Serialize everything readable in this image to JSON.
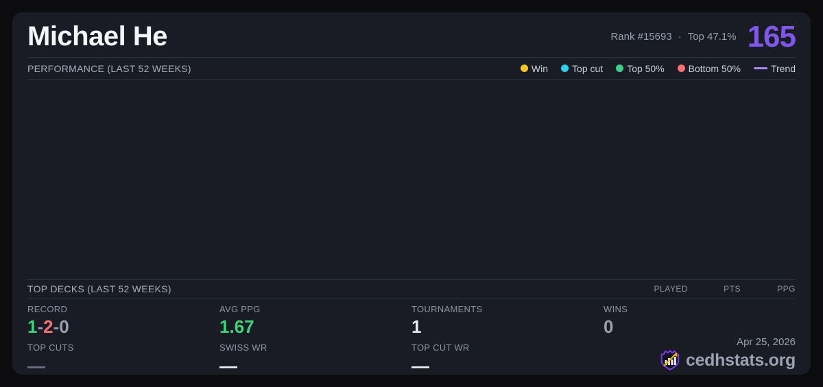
{
  "header": {
    "player_name": "Michael He",
    "rank_label": "Rank #15693",
    "separator": "·",
    "top_percent_label": "Top 47.1%",
    "score": "165"
  },
  "performance": {
    "section_title": "PERFORMANCE (LAST 52 WEEKS)",
    "legend": [
      {
        "label": "Win",
        "color": "#f2c428",
        "swatch": "dot"
      },
      {
        "label": "Top cut",
        "color": "#2ed0ec",
        "swatch": "dot"
      },
      {
        "label": "Top 50%",
        "color": "#3ecf8e",
        "swatch": "dot"
      },
      {
        "label": "Bottom 50%",
        "color": "#f87171",
        "swatch": "dot"
      },
      {
        "label": "Trend",
        "color": "#a78bfa",
        "swatch": "line"
      }
    ]
  },
  "chart_data": {
    "type": "scatter",
    "title": "PERFORMANCE (LAST 52 WEEKS)",
    "series": [],
    "legend_position": "top-right",
    "grid": false
  },
  "top_decks": {
    "section_title": "TOP DECKS (LAST 52 WEEKS)",
    "columns": [
      "PLAYED",
      "PTS",
      "PPG"
    ],
    "rows": []
  },
  "stats": {
    "record": {
      "label": "RECORD",
      "wins": "1",
      "losses": "2",
      "draws": "0",
      "separator": "-"
    },
    "avg_ppg": {
      "label": "AVG PPG",
      "value": "1.67"
    },
    "tournaments": {
      "label": "TOURNAMENTS",
      "value": "1"
    },
    "wins": {
      "label": "WINS",
      "value": "0"
    },
    "top_cuts": {
      "label": "TOP CUTS",
      "value": "—"
    },
    "swiss_wr": {
      "label": "SWISS WR",
      "value": "—"
    },
    "top_cut_wr": {
      "label": "TOP CUT WR",
      "value": "—"
    }
  },
  "footer": {
    "date": "Apr 25, 2026",
    "brand": "cedhstats.org"
  },
  "colors": {
    "page_background": "#0c0c0f",
    "card_background": "#191c25",
    "accent_purple": "#8157eb",
    "positive_green": "#3ed678",
    "negative_red": "#f87171",
    "neutral_gray": "#9aa1ae",
    "brand_purple": "#7c3aed",
    "brand_gold": "#eab308"
  }
}
